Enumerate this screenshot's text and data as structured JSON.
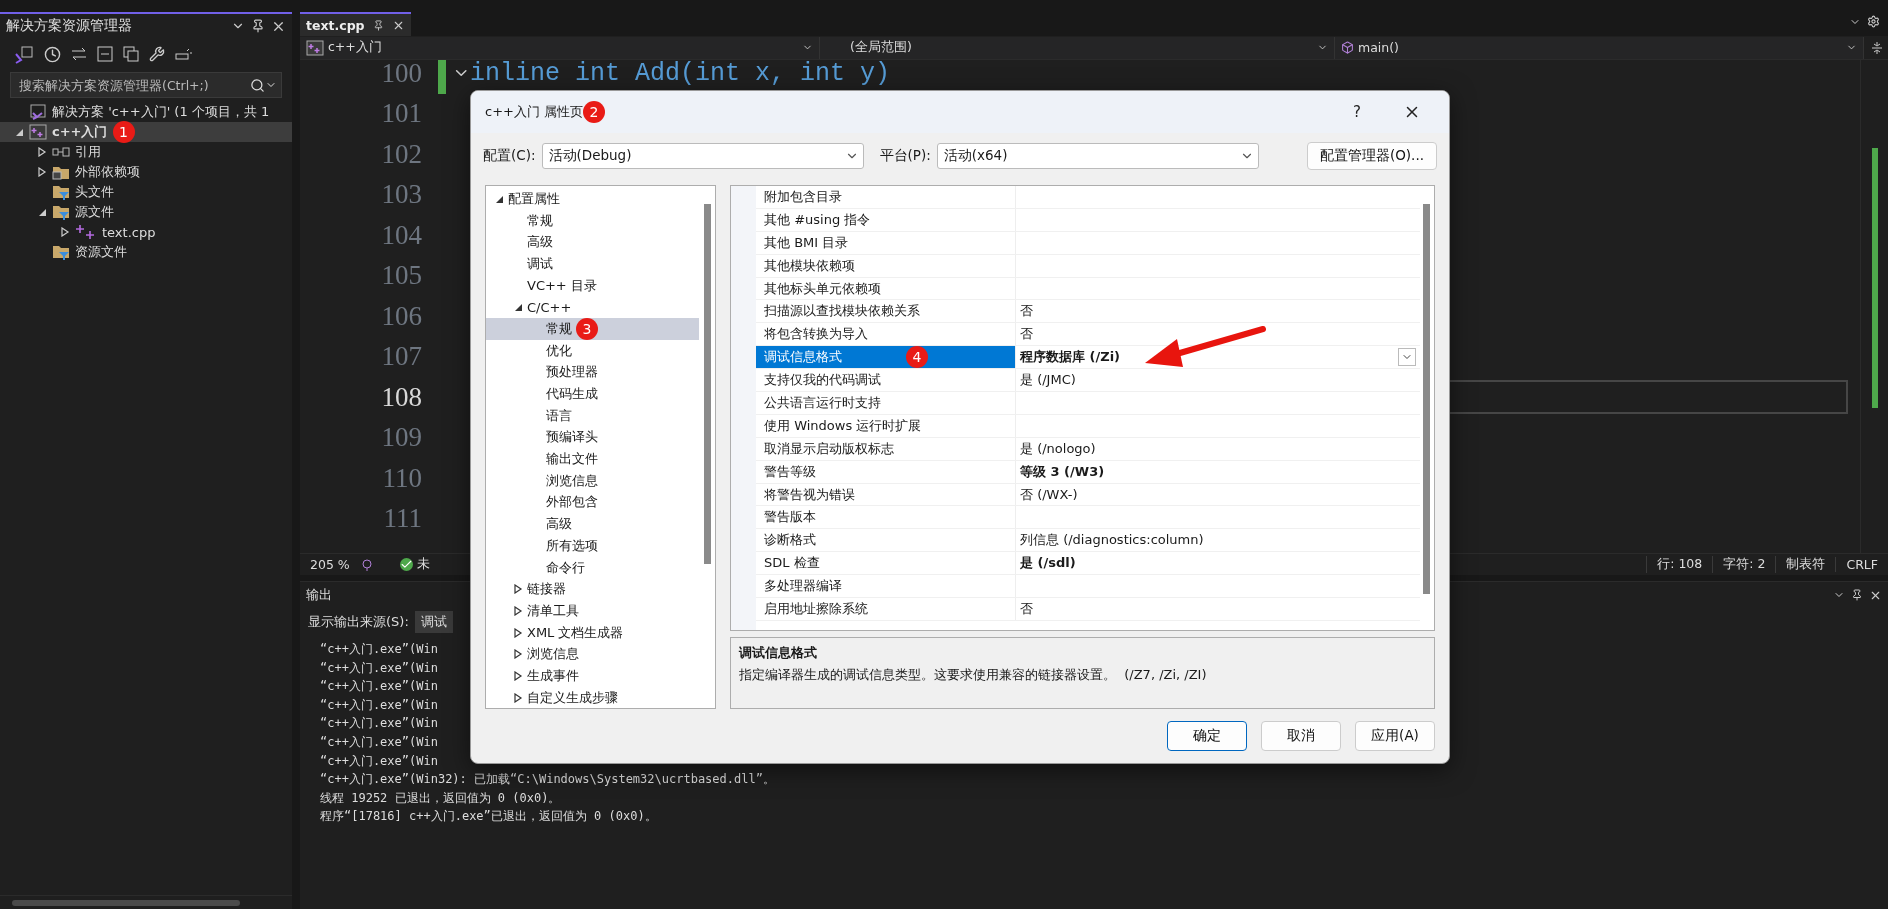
{
  "solution_explorer": {
    "title": "解决方案资源管理器",
    "search": {
      "placeholder": "搜索解决方案资源管理器(Ctrl+;)"
    },
    "tree": [
      {
        "label": "解决方案 'c++入门' (1 个项目，共 1",
        "kind": "solution",
        "selected": false
      },
      {
        "label": "c++入门",
        "kind": "project",
        "selected": true,
        "expanded": true,
        "badge": "1",
        "children": [
          {
            "label": "引用",
            "kind": "references",
            "selected": false,
            "expanded": false
          },
          {
            "label": "外部依赖项",
            "kind": "external",
            "selected": false,
            "expanded": false
          },
          {
            "label": "头文件",
            "kind": "filter",
            "selected": false
          },
          {
            "label": "源文件",
            "kind": "filter",
            "selected": false,
            "expanded": true,
            "children": [
              {
                "label": "text.cpp",
                "kind": "cpp",
                "selected": false,
                "expanded": false
              }
            ]
          },
          {
            "label": "资源文件",
            "kind": "filter",
            "selected": false
          }
        ]
      }
    ]
  },
  "editor": {
    "tabs": [
      {
        "label": "text.cpp",
        "selected": true
      }
    ],
    "navigation": [
      "c++入门",
      "(全局范围)",
      "main()"
    ],
    "lines": [
      {
        "number": "100",
        "code": "inline int Add(int x, int y)",
        "current": false
      },
      {
        "number": "101",
        "current": false
      },
      {
        "number": "102",
        "current": false
      },
      {
        "number": "103",
        "current": false
      },
      {
        "number": "104",
        "current": false
      },
      {
        "number": "105",
        "current": false
      },
      {
        "number": "106",
        "current": false
      },
      {
        "number": "107",
        "current": false
      },
      {
        "number": "108",
        "current": true
      },
      {
        "number": "109",
        "current": false
      },
      {
        "number": "110",
        "current": false
      },
      {
        "number": "111",
        "current": false
      }
    ],
    "status_bar": {
      "zoom": "205 %",
      "status": "未",
      "line": "行: 108",
      "column": "字符: 2",
      "indent": "制表符",
      "line_ending": "CRLF"
    }
  },
  "output": {
    "title": "输出",
    "source_label": "显示输出来源(S):",
    "source_value": "调试",
    "lines": [
      "“c++入门.exe”(Win",
      "“c++入门.exe”(Win",
      "“c++入门.exe”(Win",
      "“c++入门.exe”(Win",
      "“c++入门.exe”(Win",
      "“c++入门.exe”(Win",
      "“c++入门.exe”(Win",
      "“c++入门.exe”(Win32): 已加载“C:\\Windows\\System32\\ucrtbased.dll”。",
      "线程 19252 已退出，返回值为 0 (0x0)。",
      "程序“[17816] c++入门.exe”已退出，返回值为 0 (0x0)。"
    ]
  },
  "dialog": {
    "title": "c++入门 属性页",
    "badge": "2",
    "help": "?",
    "config_label": "配置(C):",
    "config_value": "活动(Debug)",
    "platform_label": "平台(P):",
    "platform_value": "活动(x64)",
    "manager_button": "配置管理器(O)...",
    "tree": [
      {
        "label": "配置属性",
        "selected": false,
        "expanded": true,
        "children": [
          {
            "label": "常规",
            "selected": false
          },
          {
            "label": "高级",
            "selected": false
          },
          {
            "label": "调试",
            "selected": false
          },
          {
            "label": "VC++ 目录",
            "selected": false
          },
          {
            "label": "C/C++",
            "selected": false,
            "expanded": true,
            "children": [
              {
                "label": "常规",
                "selected": true,
                "badge": "3"
              },
              {
                "label": "优化",
                "selected": false
              },
              {
                "label": "预处理器",
                "selected": false
              },
              {
                "label": "代码生成",
                "selected": false
              },
              {
                "label": "语言",
                "selected": false
              },
              {
                "label": "预编译头",
                "selected": false
              },
              {
                "label": "输出文件",
                "selected": false
              },
              {
                "label": "浏览信息",
                "selected": false
              },
              {
                "label": "外部包含",
                "selected": false
              },
              {
                "label": "高级",
                "selected": false
              },
              {
                "label": "所有选项",
                "selected": false
              },
              {
                "label": "命令行",
                "selected": false
              }
            ]
          },
          {
            "label": "链接器",
            "selected": false,
            "expanded": false
          },
          {
            "label": "清单工具",
            "selected": false,
            "expanded": false
          },
          {
            "label": "XML 文档生成器",
            "selected": false,
            "expanded": false
          },
          {
            "label": "浏览信息",
            "selected": false,
            "expanded": false
          },
          {
            "label": "生成事件",
            "selected": false,
            "expanded": false
          },
          {
            "label": "自定义生成步骤",
            "selected": false,
            "expanded": false
          }
        ]
      }
    ],
    "properties": [
      {
        "name": "附加包含目录",
        "selected": false
      },
      {
        "name": "其他 #using 指令",
        "selected": false
      },
      {
        "name": "其他 BMI 目录",
        "selected": false
      },
      {
        "name": "其他模块依赖项",
        "selected": false
      },
      {
        "name": "其他标头单元依赖项",
        "selected": false
      },
      {
        "name": "扫描源以查找模块依赖关系",
        "value": "否",
        "bold": false,
        "selected": false
      },
      {
        "name": "将包含转换为导入",
        "value": "否",
        "bold": false,
        "selected": false
      },
      {
        "name": "调试信息格式",
        "value": "程序数据库 (/Zi)",
        "bold": true,
        "selected": true,
        "badge": "4"
      },
      {
        "name": "支持仅我的代码调试",
        "value": "是 (/JMC)",
        "bold": false,
        "selected": false
      },
      {
        "name": "公共语言运行时支持",
        "selected": false
      },
      {
        "name": "使用 Windows 运行时扩展",
        "selected": false
      },
      {
        "name": "取消显示启动版权标志",
        "value": "是 (/nologo)",
        "bold": false,
        "selected": false
      },
      {
        "name": "警告等级",
        "value": "等级 3 (/W3)",
        "bold": true,
        "selected": false
      },
      {
        "name": "将警告视为错误",
        "value": "否 (/WX-)",
        "bold": false,
        "selected": false
      },
      {
        "name": "警告版本",
        "selected": false
      },
      {
        "name": "诊断格式",
        "value": "列信息 (/diagnostics:column)",
        "bold": false,
        "selected": false
      },
      {
        "name": "SDL 检查",
        "value": "是 (/sdl)",
        "bold": true,
        "selected": false
      },
      {
        "name": "多处理器编译",
        "selected": false
      },
      {
        "name": "启用地址擦除系统",
        "value": "否",
        "bold": false,
        "selected": false
      }
    ],
    "description": {
      "title": "调试信息格式",
      "text": "指定编译器生成的调试信息类型。这要求使用兼容的链接器设置。  (/Z7, /Zi, /ZI)"
    },
    "buttons": [
      {
        "label": "确定",
        "primary": true
      },
      {
        "label": "取消",
        "primary": false
      },
      {
        "label": "应用(A)",
        "primary": false
      }
    ]
  }
}
